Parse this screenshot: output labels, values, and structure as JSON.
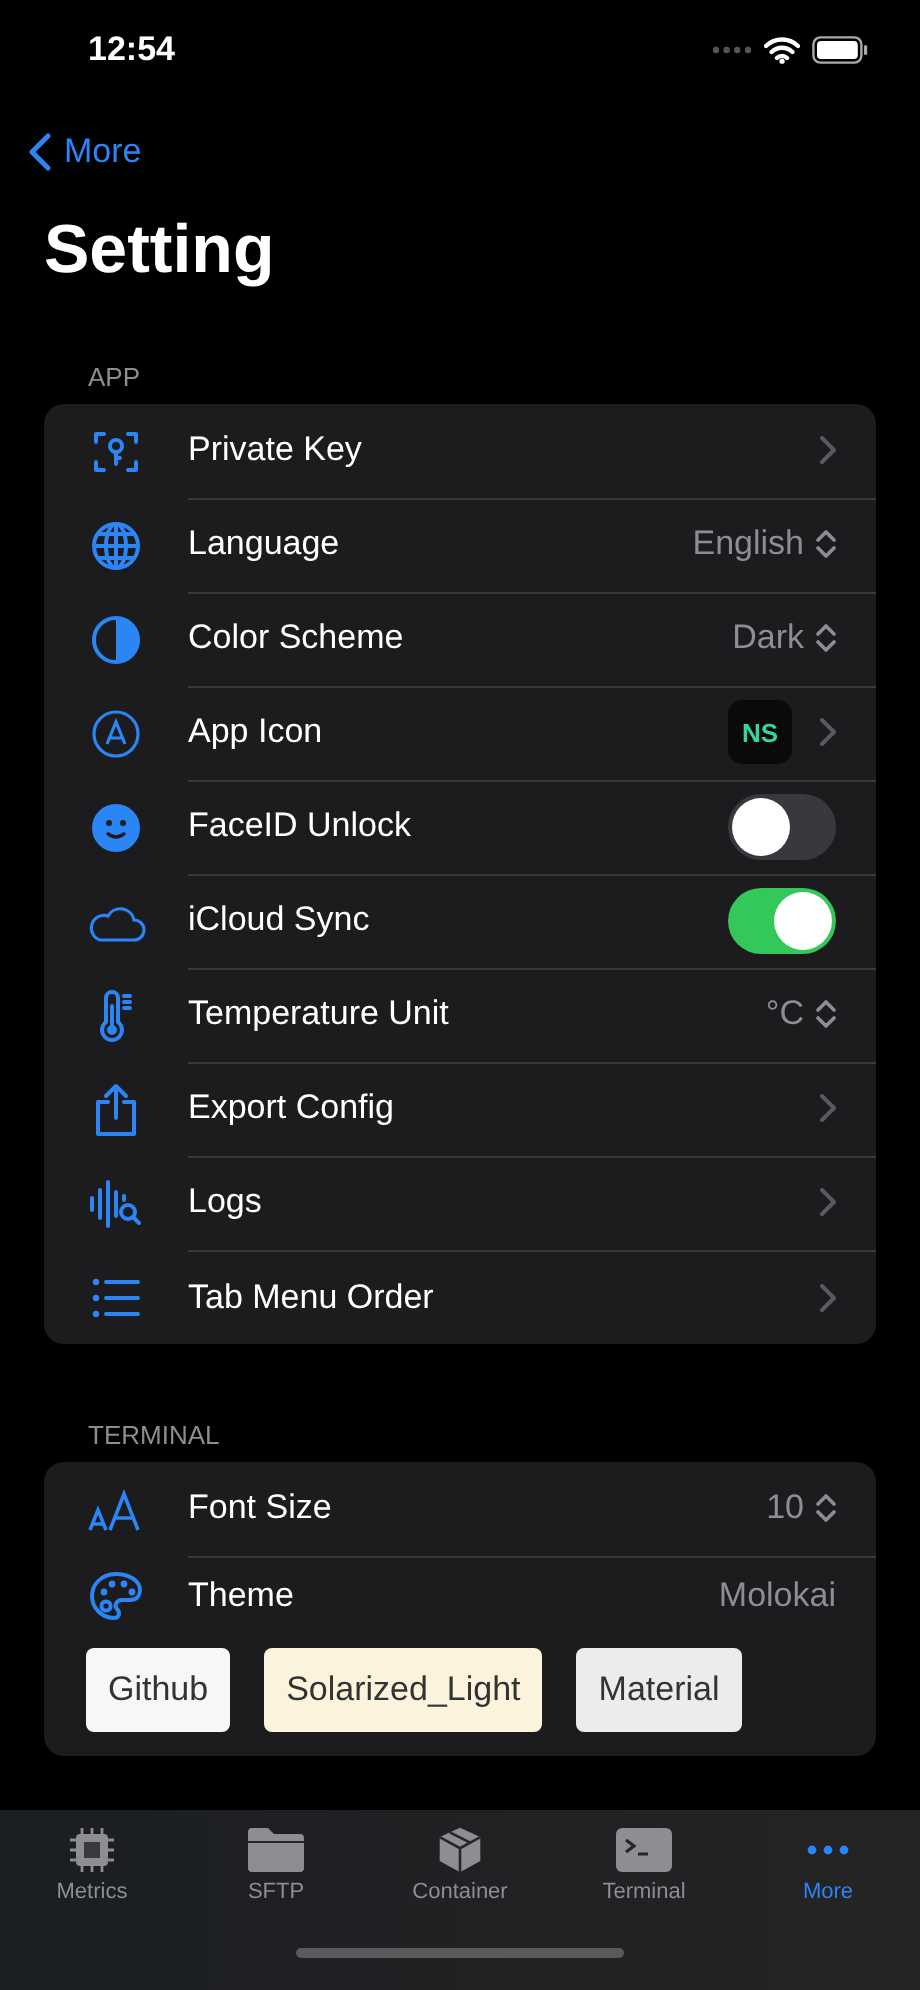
{
  "status_bar": {
    "time": "12:54"
  },
  "nav": {
    "back_label": "More",
    "title": "Setting"
  },
  "sections": [
    {
      "header": "APP",
      "rows": [
        {
          "label": "Private Key",
          "kind": "link"
        },
        {
          "label": "Language",
          "kind": "picker",
          "value": "English"
        },
        {
          "label": "Color Scheme",
          "kind": "picker",
          "value": "Dark"
        },
        {
          "label": "App Icon",
          "kind": "app_icon",
          "icon_text": "NS"
        },
        {
          "label": "FaceID Unlock",
          "kind": "toggle",
          "on": false
        },
        {
          "label": "iCloud Sync",
          "kind": "toggle",
          "on": true
        },
        {
          "label": "Temperature Unit",
          "kind": "picker",
          "value": "°C"
        },
        {
          "label": "Export Config",
          "kind": "link"
        },
        {
          "label": "Logs",
          "kind": "link"
        },
        {
          "label": "Tab Menu Order",
          "kind": "link"
        }
      ]
    },
    {
      "header": "TERMINAL",
      "rows": [
        {
          "label": "Font Size",
          "kind": "picker",
          "value": "10"
        },
        {
          "label": "Theme",
          "kind": "text",
          "value": "Molokai"
        }
      ],
      "themes": [
        {
          "label": "Github",
          "color": "#f7f7f7"
        },
        {
          "label": "Solarized_Light",
          "color": "#fbf3dc"
        },
        {
          "label": "Material",
          "color": "#ececec"
        }
      ]
    }
  ],
  "tab_bar": [
    {
      "label": "Metrics",
      "selected": false
    },
    {
      "label": "SFTP",
      "selected": false
    },
    {
      "label": "Container",
      "selected": false
    },
    {
      "label": "Terminal",
      "selected": false
    },
    {
      "label": "More",
      "selected": true
    }
  ]
}
